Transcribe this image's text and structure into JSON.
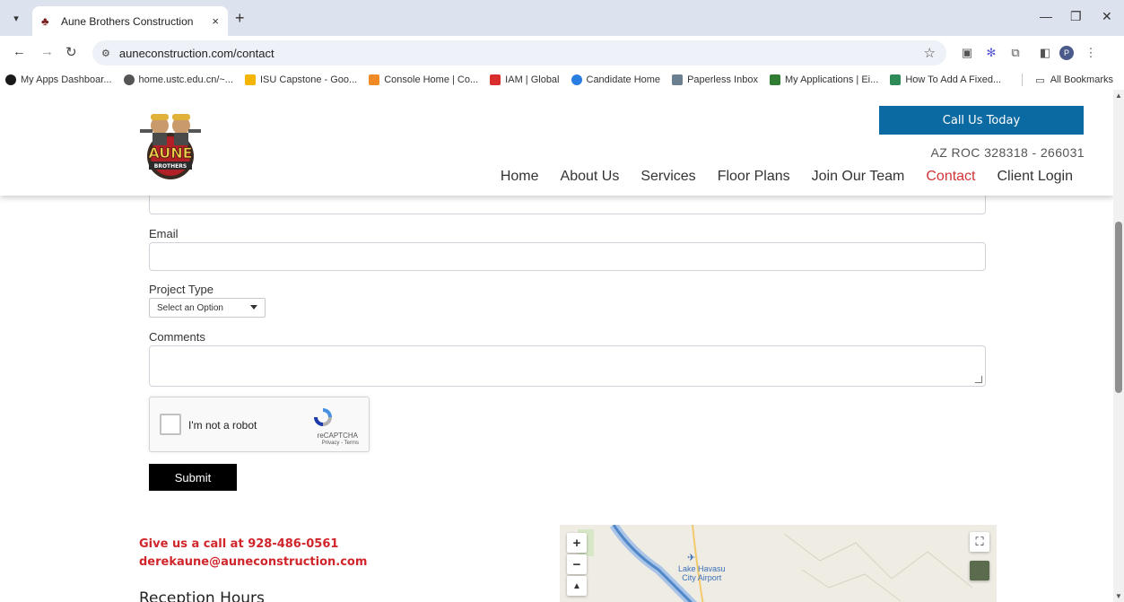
{
  "browser": {
    "tab_title": "Aune Brothers Construction",
    "tab_close": "×",
    "new_tab": "+",
    "url": "auneconstruction.com/contact",
    "profile_initial": "P",
    "bookmarks": [
      {
        "label": "My Apps Dashboar...",
        "color": "#1a1a1a"
      },
      {
        "label": "home.ustc.edu.cn/~...",
        "color": "#555555"
      },
      {
        "label": "ISU Capstone - Goo...",
        "color": "#f4b400"
      },
      {
        "label": "Console Home | Co...",
        "color": "#f08a24"
      },
      {
        "label": "IAM | Global",
        "color": "#d92d2d"
      },
      {
        "label": "Candidate Home",
        "color": "#2a7de1"
      },
      {
        "label": "Paperless Inbox",
        "color": "#6a7f8f"
      },
      {
        "label": "My Applications | Ei...",
        "color": "#2e7d32"
      },
      {
        "label": "How To Add A Fixed...",
        "color": "#2e8b57"
      }
    ],
    "all_bookmarks": "All Bookmarks"
  },
  "header": {
    "logo_text": "AUNE",
    "logo_subtext": "BROTHERS",
    "call_button": "Call Us Today",
    "roc": "AZ ROC 328318 - 266031",
    "nav": [
      "Home",
      "About Us",
      "Services",
      "Floor Plans",
      "Join Our Team",
      "Contact",
      "Client Login"
    ],
    "active_nav": "Contact",
    "accent": "#d0343a",
    "brand_blue": "#0b6aa2"
  },
  "form": {
    "email_label": "Email",
    "project_type_label": "Project Type",
    "project_type_value": "Select an Option",
    "comments_label": "Comments",
    "recaptcha_text": "I'm not a robot",
    "recaptcha_brand": "reCAPTCHA",
    "recaptcha_links": "Privacy - Terms",
    "submit_label": "Submit"
  },
  "contact": {
    "phone_line": "Give us a call at 928-486-0561",
    "email_line": "derekaune@auneconstruction.com",
    "reception_heading": "Reception Hours"
  },
  "map": {
    "zoom_in": "+",
    "zoom_out": "−",
    "label_line1": "Lake Havasu",
    "label_line2": "City Airport"
  }
}
